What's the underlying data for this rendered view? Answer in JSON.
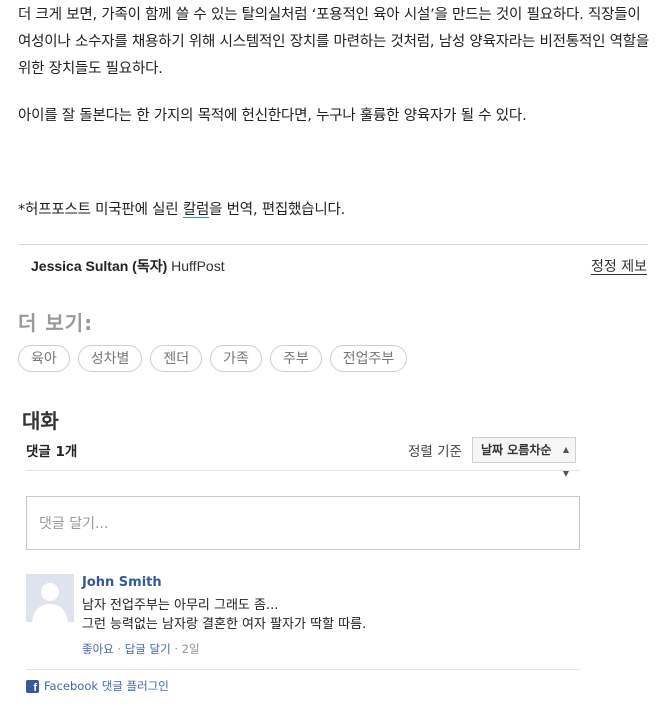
{
  "article": {
    "para1": "더 크게 보면, 가족이 함께 쓸 수 있는 탈의실처럼 ‘포용적인 육아 시설’을 만드는 것이 필요하다. 직장들이 여성이나 소수자를 채용하기 위해 시스템적인 장치를 마련하는 것처럼, 남성 양육자라는 비전통적인 역할을 위한 장치들도 필요하다.",
    "para2": "아이를 잘 돌본다는 한 가지의 목적에 헌신한다면, 누구나 훌륭한 양육자가 될 수 있다.",
    "note_before": "*허프포스트 미국판에 실린 ",
    "note_link": "칼럼",
    "note_after": "을 번역, 편집했습니다."
  },
  "byline": {
    "author": "Jessica Sultan (독자)",
    "outlet": "HuffPost",
    "report": "정정 제보"
  },
  "more": {
    "title": "더 보기:",
    "tags": [
      "육아",
      "성차별",
      "젠더",
      "가족",
      "주부",
      "전업주부"
    ]
  },
  "comments": {
    "title": "대화",
    "count": "댓글 1개",
    "sort_label": "정렬 기준",
    "sort_value": "날짜 오름차순",
    "input_placeholder": "댓글 달기...",
    "items": [
      {
        "name": "John Smith",
        "line1": "남자 전업주부는 아무리 그래도 좀...",
        "line2": "그런 능력없는 남자랑 결혼한 여자 팔자가 딱할 따름.",
        "like": "좋아요",
        "reply": "답글 달기",
        "time": "2일"
      }
    ],
    "plugin": "Facebook 댓글 플러그인"
  },
  "colors": {
    "fb_link": "#365899",
    "fb_blue": "#3b5998",
    "tag_border": "#cfcfcf"
  }
}
